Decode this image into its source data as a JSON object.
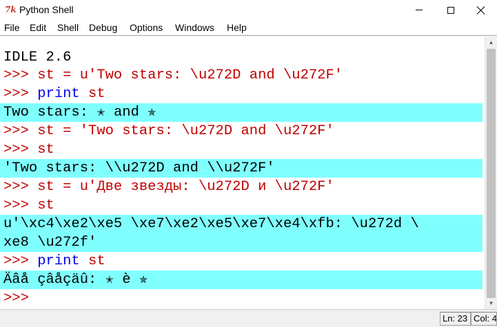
{
  "window": {
    "icon_text": "7k",
    "title": "Python Shell"
  },
  "menu": [
    "File",
    "Edit",
    "Shell",
    "Debug",
    "Options",
    "Windows",
    "Help"
  ],
  "shell": {
    "lines": [
      {
        "kind": "banner",
        "text": "IDLE 2.6"
      },
      {
        "kind": "input",
        "prompt": ">>> ",
        "code": "st = u'Two stars: \\u272D and \\u272F'"
      },
      {
        "kind": "input",
        "prompt": ">>> ",
        "keyword": "print",
        "code": " st"
      },
      {
        "kind": "output",
        "text": "Two stars: ✭ and ✯"
      },
      {
        "kind": "input",
        "prompt": ">>> ",
        "code": "st = 'Two stars: \\u272D and \\u272F'"
      },
      {
        "kind": "input",
        "prompt": ">>> ",
        "code": "st"
      },
      {
        "kind": "output",
        "text": "'Two stars: \\\\u272D and \\\\u272F'"
      },
      {
        "kind": "input",
        "prompt": ">>> ",
        "code": "st = u'Две звезды: \\u272D и \\u272F'"
      },
      {
        "kind": "input",
        "prompt": ">>> ",
        "code": "st"
      },
      {
        "kind": "output",
        "text": "u'\\xc4\\xe2\\xe5 \\xe7\\xe2\\xe5\\xe7\\xe4\\xfb: \\u272d \\"
      },
      {
        "kind": "output",
        "text": "xe8 \\u272f'"
      },
      {
        "kind": "input",
        "prompt": ">>> ",
        "keyword": "print",
        "code": " st"
      },
      {
        "kind": "output",
        "text": "Äâå çâåçäû: ✭ è ✯"
      },
      {
        "kind": "prompt-only",
        "prompt": ">>>"
      }
    ]
  },
  "status": {
    "ln": "Ln: 23",
    "col": "Col: 4"
  },
  "colors": {
    "prompt": "#c00000",
    "output_bg": "#80ffff",
    "keyword": "#0000ee"
  }
}
